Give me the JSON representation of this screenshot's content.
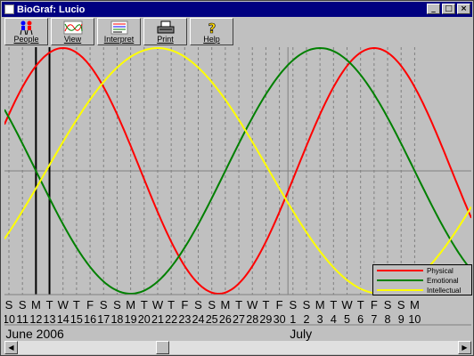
{
  "window": {
    "title": "BioGraf: Lucio"
  },
  "titlebar": {
    "minimize": "_",
    "maximize": "□",
    "close": "×"
  },
  "toolbar": {
    "people": "People",
    "view": "View",
    "interpret": "Interpret",
    "print": "Print",
    "help": "Help"
  },
  "legend": {
    "physical": "Physical",
    "emotional": "Emotional",
    "intellectual": "Intellectual"
  },
  "colors": {
    "physical": "#ff0000",
    "emotional": "#008000",
    "intellectual": "#ffff00",
    "plot_bg": "#c0c0c0",
    "grid": "#808080"
  },
  "chart_data": {
    "type": "line",
    "series": [
      {
        "name": "Physical",
        "period_days": 23,
        "peak_date": "2006-06-14"
      },
      {
        "name": "Emotional",
        "period_days": 28,
        "peak_date": "2006-07-03"
      },
      {
        "name": "Intellectual",
        "period_days": 33,
        "peak_date": "2006-06-21"
      }
    ],
    "weekdays": [
      "S",
      "S",
      "M",
      "T",
      "W",
      "T",
      "F",
      "S",
      "S",
      "M",
      "T",
      "W",
      "T",
      "F",
      "S",
      "S",
      "M",
      "T",
      "W",
      "T",
      "F",
      "S",
      "S",
      "M",
      "T",
      "W",
      "T",
      "F",
      "S",
      "S",
      "M",
      "T",
      "W",
      "T",
      "F",
      "S",
      "S",
      "M"
    ],
    "dates": [
      "10",
      "11",
      "12",
      "13",
      "14",
      "15",
      "16",
      "17",
      "18",
      "19",
      "20",
      "21",
      "22",
      "23",
      "24",
      "25",
      "26",
      "27",
      "28",
      "29",
      "30",
      "1",
      "2",
      "3",
      "4",
      "5",
      "6",
      "7",
      "8",
      "9",
      "10"
    ],
    "months": [
      {
        "label": "June 2006",
        "start_index": 0
      },
      {
        "label": "July",
        "start_index": 21
      }
    ],
    "marked_dates": [
      "2006-06-12",
      "2006-06-13"
    ],
    "ylim": [
      -1,
      1
    ],
    "grid": true
  }
}
